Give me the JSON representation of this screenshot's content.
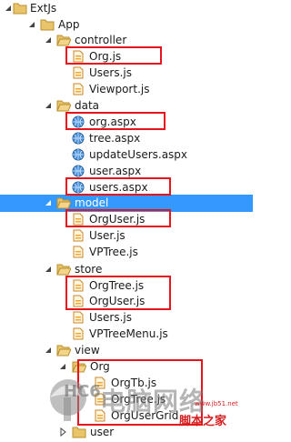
{
  "tree": {
    "root": "ExtJs",
    "app": "App",
    "controller": "controller",
    "controller_files": [
      "Org.js",
      "Users.js",
      "Viewport.js"
    ],
    "data": "data",
    "data_files": [
      "org.aspx",
      "tree.aspx",
      "updateUsers.aspx",
      "user.aspx",
      "users.aspx"
    ],
    "model": "model",
    "model_files": [
      "OrgUser.js",
      "User.js",
      "VPTree.js"
    ],
    "store": "store",
    "store_files": [
      "OrgTree.js",
      "OrgUser.js",
      "Users.js",
      "VPTreeMenu.js"
    ],
    "view": "view",
    "view_org": "Org",
    "view_org_files": [
      "OrgTb.js",
      "OrgTree.js",
      "OrgUserGrid"
    ],
    "view_user": "user"
  },
  "watermark": {
    "main": "电脑网络",
    "sub1": "脚本之家",
    "site": "www.jb51.net",
    "cn": "HC6"
  },
  "colors": {
    "selection": "#3399ff",
    "highlight_box": "#e8141c",
    "folder": "#e9c46a",
    "js_file": "#f0a830"
  }
}
